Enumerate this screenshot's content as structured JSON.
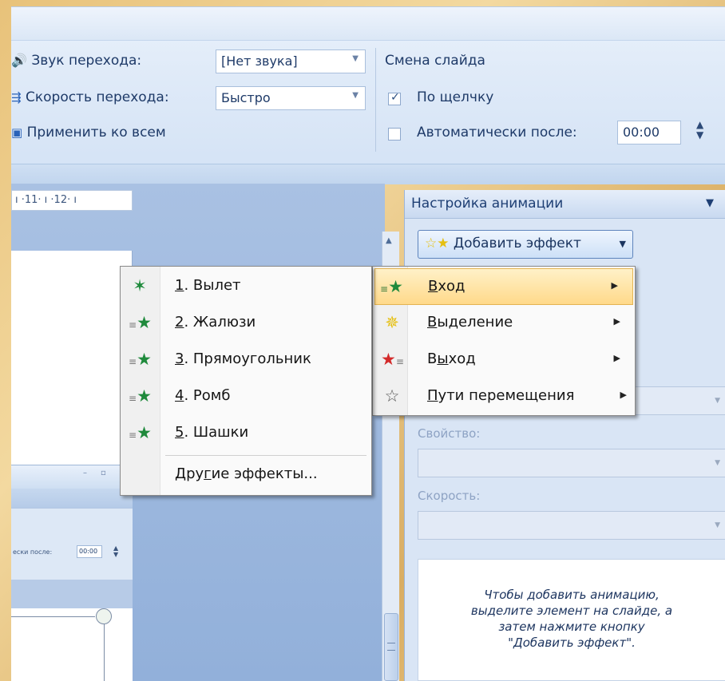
{
  "ribbon": {
    "sound_label": "Звук перехода:",
    "sound_value": "[Нет звука]",
    "speed_label": "Скорость перехода:",
    "speed_value": "Быстро",
    "apply_all_label": "Применить ко всем",
    "slide_change_title": "Смена слайда",
    "on_click_label": "По щелчку",
    "on_click_checked": true,
    "auto_after_label": "Автоматически после:",
    "auto_after_value": "00:00"
  },
  "ruler": {
    "text": "ı ·11· ı ·12· ı"
  },
  "thumbnail": {
    "auto_after_label": "ески после:",
    "auto_after_value": "00:00"
  },
  "pane": {
    "title": "Настройка анимации",
    "add_effect_label": "Добавить эффект",
    "property_label": "Свойство:",
    "speed_label": "Скорость:",
    "hint_lines": [
      "Чтобы добавить анимацию,",
      "выделите элемент на слайде, а",
      "затем нажмите кнопку",
      "\"Добавить эффект\"."
    ]
  },
  "effect_menu": {
    "items": [
      {
        "key": "В",
        "rest": "ход",
        "icon": "entrance-icon",
        "has_submenu": true,
        "highlighted": true
      },
      {
        "key": "В",
        "rest": "ыделение",
        "icon": "emphasis-icon",
        "has_submenu": true,
        "highlighted": false
      },
      {
        "prefix": "В",
        "key": "ы",
        "rest": "ход",
        "icon": "exit-icon",
        "has_submenu": true,
        "highlighted": false
      },
      {
        "key": "П",
        "rest": "ути перемещения",
        "icon": "motion-path-icon",
        "has_submenu": true,
        "highlighted": false
      }
    ]
  },
  "entrance_menu": {
    "items": [
      {
        "num": "1",
        "label": ". Вылет"
      },
      {
        "num": "2",
        "label": ". Жалюзи"
      },
      {
        "num": "3",
        "label": ". Прямоугольник"
      },
      {
        "num": "4",
        "label": ". Ромб"
      },
      {
        "num": "5",
        "label": ". Шашки"
      }
    ],
    "more_prefix": "Дру",
    "more_key": "г",
    "more_rest": "ие эффекты..."
  }
}
